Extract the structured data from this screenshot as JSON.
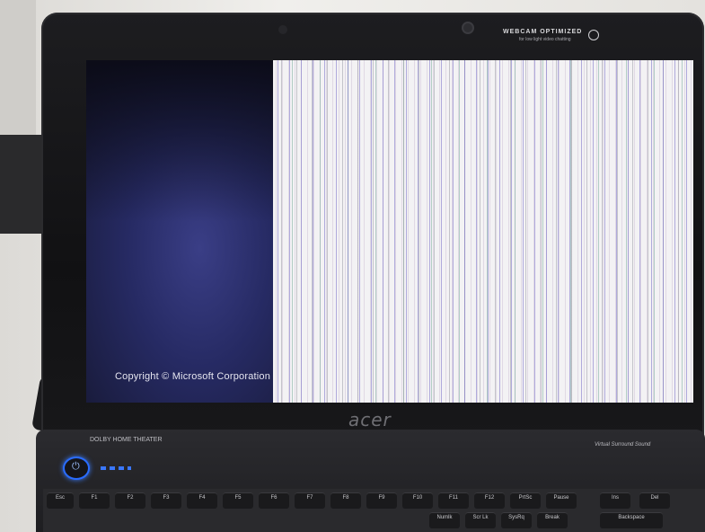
{
  "screen": {
    "copyright": "Copyright © Microsoft Corporation"
  },
  "bezel": {
    "webcam_badge_title": "WEBCAM OPTIMIZED",
    "webcam_badge_subtitle": "for low light video chatting",
    "brand_logo": "acer"
  },
  "chassis": {
    "dolby_label": "DOLBY HOME THEATER",
    "surround_label": "Virtual Surround Sound"
  },
  "keyboard": {
    "keys": [
      "Esc",
      "F1",
      "F2",
      "F3",
      "F4",
      "F5",
      "F6",
      "F7",
      "F8",
      "F9",
      "F10",
      "F11",
      "F12",
      "PrtSc",
      "Pause",
      "Ins",
      "Del"
    ],
    "sub_labels": [
      "Numlk",
      "Scr Lk",
      "SysRq",
      "Break"
    ],
    "backspace": "Backspace"
  },
  "colors": {
    "screen_left": "#262a63",
    "screen_stripes_bg": "#f3f2f4",
    "bezel": "#141416",
    "power_led": "#2a6cff"
  }
}
